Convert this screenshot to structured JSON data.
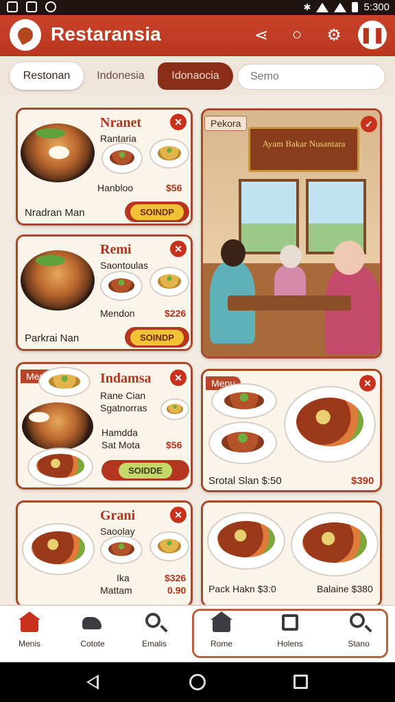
{
  "status_bar": {
    "time": "5:300"
  },
  "app": {
    "title": "Restaransia"
  },
  "filters": {
    "chips": [
      "Restonan",
      "Indonesia",
      "Idonaocia"
    ],
    "search_placeholder": "Semo"
  },
  "cards": [
    {
      "name": "Nranet",
      "sub": "Rantaria",
      "item2": "Hanbloo",
      "price": "$56",
      "footer": "Nradran Man",
      "button": "SOINDP"
    },
    {
      "name": "Remi",
      "sub": "Saontoulas",
      "item2": "Mendon",
      "price": "$226",
      "footer": "Parkrai Nan",
      "button": "SOINDP"
    },
    {
      "name": "Indamsa",
      "tag": "Menu",
      "sub": "Rane Cian",
      "sub2": "Sgatnorras",
      "item2": "Hamdda",
      "item3": "Sat Mota",
      "price": "$56",
      "button": "SOIDDE"
    },
    {
      "name": "Grani",
      "sub": "Saoolay",
      "item2": "Ika",
      "item3": "Mattam",
      "price": "$326",
      "price2": "0.90"
    }
  ],
  "scene": {
    "ribbon": "Pekora",
    "sign_text": "Ayam Bakar Nusantara"
  },
  "right_cards": [
    {
      "tag": "Menu",
      "footer": "Srotal Slan $:50",
      "price": "$390"
    },
    {
      "footer_left": "Pack Hakn $3:0",
      "footer_right": "Balaine $380"
    }
  ],
  "bottom_nav": [
    {
      "label": "Menis",
      "icon": "home-icon"
    },
    {
      "label": "Cotote",
      "icon": "dog-icon"
    },
    {
      "label": "Emalis",
      "icon": "search-icon"
    },
    {
      "label": "Rome",
      "icon": "home-icon"
    },
    {
      "label": "Holens",
      "icon": "box-icon"
    },
    {
      "label": "Stano",
      "icon": "search-icon"
    }
  ],
  "colors": {
    "primary": "#b8361f",
    "accent": "#f1c233",
    "card_bg": "#fbf4ea"
  }
}
